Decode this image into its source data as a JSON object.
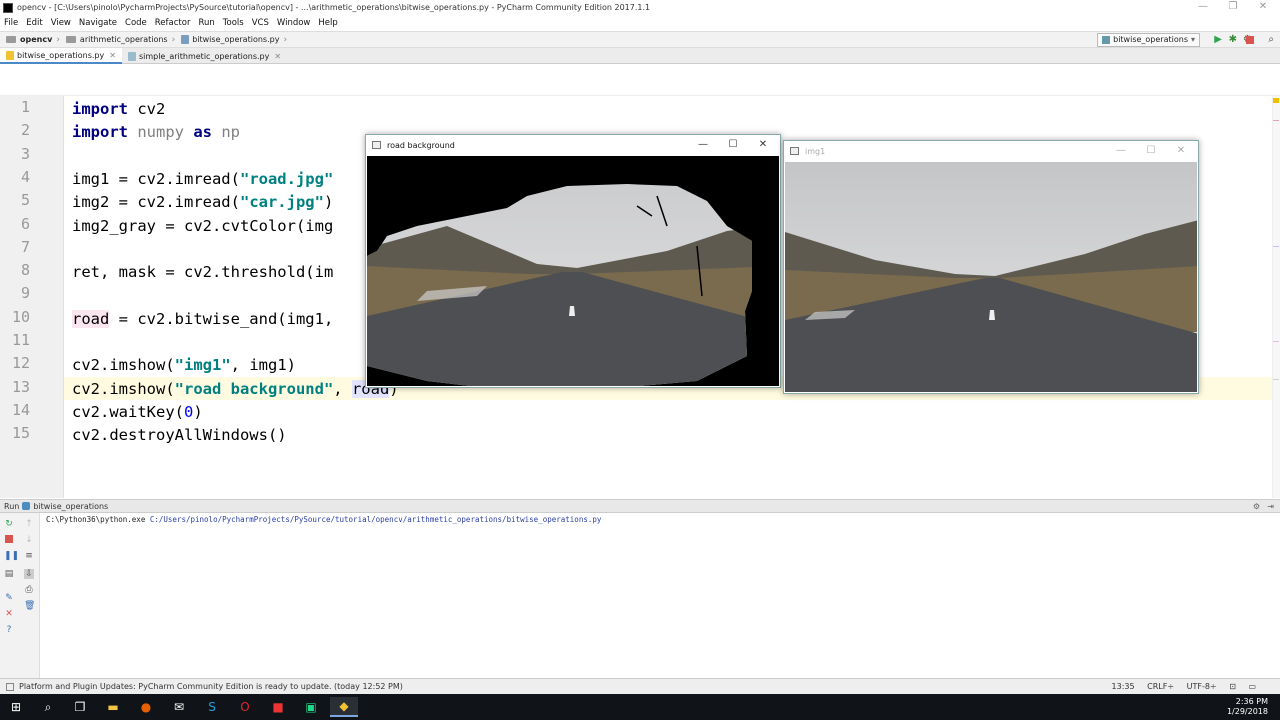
{
  "window": {
    "title": "opencv - [C:\\Users\\pinolo\\PycharmProjects\\PySource\\tutorial\\opencv] - ...\\arithmetic_operations\\bitwise_operations.py - PyCharm Community Edition 2017.1.1"
  },
  "menu": [
    "File",
    "Edit",
    "View",
    "Navigate",
    "Code",
    "Refactor",
    "Run",
    "Tools",
    "VCS",
    "Window",
    "Help"
  ],
  "navbar": {
    "crumbs": [
      "opencv",
      "arithmetic_operations",
      "bitwise_operations.py"
    ],
    "run_config": "bitwise_operations"
  },
  "tabs": [
    "bitwise_operations.py",
    "simple_arithmetic_operations.py"
  ],
  "code": {
    "line_numbers": [
      "1",
      "2",
      "3",
      "4",
      "5",
      "6",
      "7",
      "8",
      "9",
      "10",
      "11",
      "12",
      "13",
      "14",
      "15"
    ],
    "lines": [
      [
        {
          "t": "import",
          "c": "kw"
        },
        {
          "t": " cv2",
          "c": ""
        }
      ],
      [
        {
          "t": "import",
          "c": "kw"
        },
        {
          "t": " numpy ",
          "c": "dim"
        },
        {
          "t": "as",
          "c": "kw"
        },
        {
          "t": " np",
          "c": "dim"
        }
      ],
      [],
      [
        {
          "t": "img1 = cv2.imread(",
          "c": ""
        },
        {
          "t": "\"road.jpg\"",
          "c": "str"
        }
      ],
      [
        {
          "t": "img2 = cv2.imread(",
          "c": ""
        },
        {
          "t": "\"car.jpg\"",
          "c": "str"
        },
        {
          "t": ")",
          "c": ""
        }
      ],
      [
        {
          "t": "img2_gray = cv2.cvtColor(img",
          "c": ""
        }
      ],
      [],
      [
        {
          "t": "ret, mask = cv2.threshold(im",
          "c": ""
        }
      ],
      [],
      [
        {
          "t": "road",
          "c": "hl-var"
        },
        {
          "t": " = cv2.bitwise_and(img1,",
          "c": ""
        }
      ],
      [],
      [
        {
          "t": "cv2.imshow(",
          "c": ""
        },
        {
          "t": "\"img1\"",
          "c": "str"
        },
        {
          "t": ", img1)",
          "c": ""
        }
      ],
      [
        {
          "t": "cv2.imshow(",
          "c": ""
        },
        {
          "t": "\"road background\"",
          "c": "str"
        },
        {
          "t": ", ",
          "c": ""
        },
        {
          "t": "road",
          "c": "hl-ref"
        },
        {
          "t": ")",
          "c": ""
        }
      ],
      [
        {
          "t": "cv2.waitKey(",
          "c": ""
        },
        {
          "t": "0",
          "c": "num"
        },
        {
          "t": ")",
          "c": ""
        }
      ],
      [
        {
          "t": "cv2.destroyAllWindows()",
          "c": ""
        }
      ]
    ]
  },
  "cv_windows": {
    "road_bg": {
      "title": "road background"
    },
    "img1": {
      "title": "img1"
    }
  },
  "run_panel": {
    "label": "Run",
    "config": "bitwise_operations",
    "exe": "C:\\Python36\\python.exe",
    "script": "C:/Users/pinolo/PycharmProjects/PySource/tutorial/opencv/arithmetic_operations/bitwise_operations.py"
  },
  "status": {
    "message": "Platform and Plugin Updates: PyCharm Community Edition is ready to update. (today 12:52 PM)",
    "position": "13:35",
    "line_sep": "CRLF÷",
    "encoding": "UTF-8÷"
  },
  "taskbar": {
    "time": "2:36 PM",
    "date": "1/29/2018"
  },
  "colors": {
    "keyword": "#000080",
    "string": "#008080",
    "accent": "#4a88c7",
    "taskbar": "#101418"
  },
  "icons": [
    "windows-start-icon",
    "search-icon",
    "task-view-icon",
    "file-explorer-icon",
    "firefox-icon",
    "mail-icon",
    "skype-icon",
    "opera-icon",
    "pycharm-icon",
    "python-icon"
  ]
}
